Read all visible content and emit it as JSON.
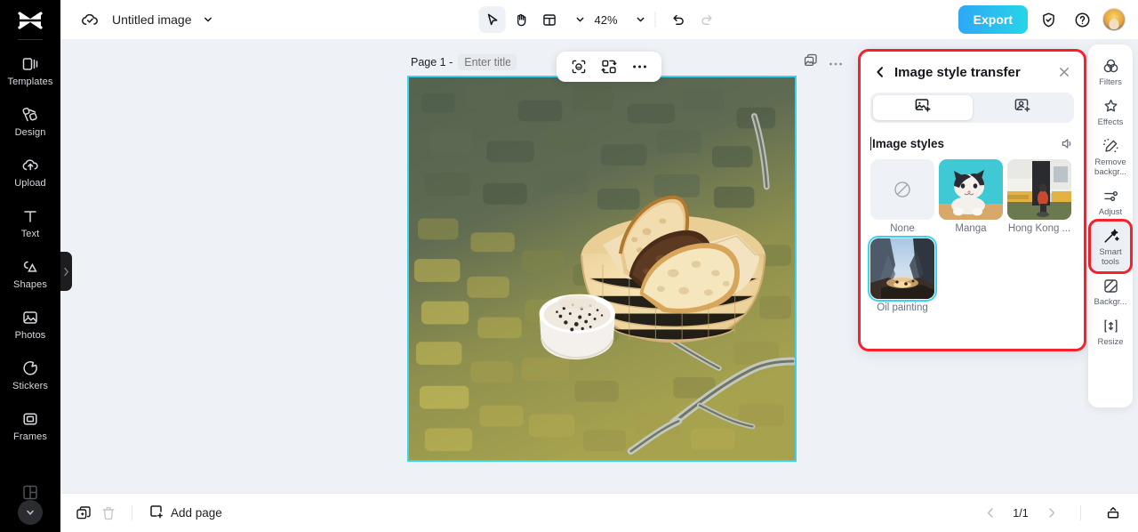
{
  "app": {
    "logo": "capcut-logo",
    "title": "Untitled image",
    "cloud_icon": "cloud-check-icon",
    "title_caret_icon": "chevron-down-icon"
  },
  "sidebar": {
    "items": [
      {
        "label": "Templates",
        "icon": "templates-icon"
      },
      {
        "label": "Design",
        "icon": "design-icon"
      },
      {
        "label": "Upload",
        "icon": "upload-cloud-icon"
      },
      {
        "label": "Text",
        "icon": "text-icon"
      },
      {
        "label": "Shapes",
        "icon": "shapes-icon"
      },
      {
        "label": "Photos",
        "icon": "photos-icon"
      },
      {
        "label": "Stickers",
        "icon": "stickers-icon"
      },
      {
        "label": "Frames",
        "icon": "frames-icon"
      }
    ],
    "expand_icon": "chevron-down-icon",
    "collapse_handle_icon": "chevron-right-icon"
  },
  "toolbar": {
    "select_icon": "cursor-select-icon",
    "hand_icon": "hand-pan-icon",
    "layout_icon": "layout-grid-icon",
    "layout_caret_icon": "chevron-down-icon",
    "zoom_caret_icon": "chevron-down-icon",
    "zoom_value": "42%",
    "zoom_caret2_icon": "chevron-down-icon",
    "undo_icon": "undo-icon",
    "redo_icon": "redo-icon",
    "export_label": "Export",
    "shield_icon": "shield-check-icon",
    "help_icon": "help-circle-icon",
    "avatar": "user-avatar"
  },
  "canvas": {
    "page_label": "Page 1 -",
    "title_placeholder": "Enter title",
    "duplicate_icon": "duplicate-page-icon",
    "more_icon": "more-horizontal-icon",
    "float_toolbar": {
      "cutout_icon": "magic-cutout-icon",
      "replace_icon": "replace-image-icon",
      "more_icon": "more-horizontal-icon"
    },
    "artwork": "oil-painting-bread-basket"
  },
  "style_panel": {
    "back_icon": "chevron-left-icon",
    "title": "Image style transfer",
    "close_icon": "close-icon",
    "tabs": [
      {
        "name": "image-styles-tab",
        "icon": "image-style-icon",
        "active": true
      },
      {
        "name": "portrait-styles-tab",
        "icon": "portrait-style-icon",
        "active": false
      }
    ],
    "section_title": "Image styles",
    "speaker_icon": "speaker-icon",
    "styles": [
      {
        "label": "None",
        "icon": "no-style-icon",
        "selected": false
      },
      {
        "label": "Manga",
        "thumb": "manga-cat-thumb",
        "selected": false
      },
      {
        "label": "Hong Kong ...",
        "thumb": "hong-kong-van-thumb",
        "selected": false
      },
      {
        "label": "Oil painting",
        "thumb": "oil-painting-valley-thumb",
        "selected": true
      }
    ]
  },
  "right_rail": {
    "items": [
      {
        "label": "Filters",
        "icon": "filters-icon",
        "active": false,
        "annotated": false
      },
      {
        "label": "Effects",
        "icon": "effects-icon",
        "active": false,
        "annotated": false
      },
      {
        "label": "Remove backgr...",
        "icon": "remove-background-icon",
        "active": false,
        "annotated": false
      },
      {
        "label": "Adjust",
        "icon": "adjust-sliders-icon",
        "active": false,
        "annotated": false
      },
      {
        "label": "Smart tools",
        "icon": "magic-wand-icon",
        "active": true,
        "annotated": true
      },
      {
        "label": "Backgr...",
        "icon": "background-icon",
        "active": false,
        "annotated": false
      },
      {
        "label": "Resize",
        "icon": "resize-icon",
        "active": false,
        "annotated": false
      }
    ]
  },
  "bottom_bar": {
    "duplicate_icon": "duplicate-icon",
    "delete_icon": "trash-icon",
    "add_page_icon": "add-page-icon",
    "add_page_label": "Add page",
    "prev_icon": "chevron-left-icon",
    "page_indicator": "1/1",
    "next_icon": "chevron-right-icon",
    "timeline_icon": "timeline-icon"
  },
  "colors": {
    "accent_cyan": "#39d2ef",
    "annotation_red": "#f5222d",
    "export_gradient_start": "#2fa7f5",
    "export_gradient_end": "#25d5e8",
    "rail_black": "#000000",
    "canvas_bg": "#eef1f5"
  }
}
